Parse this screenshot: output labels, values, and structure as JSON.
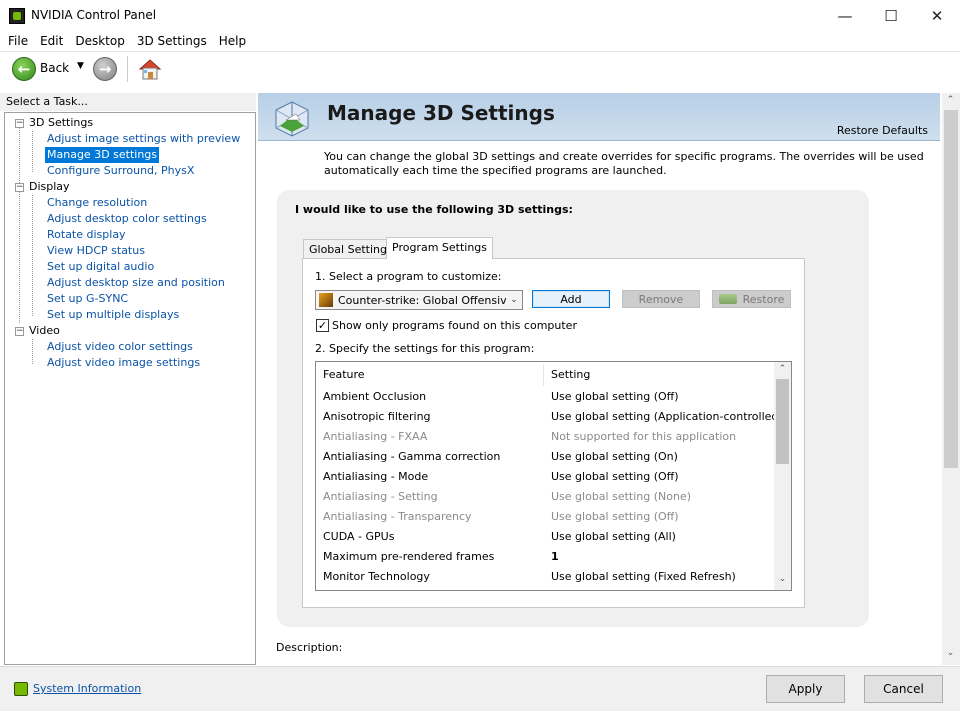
{
  "window": {
    "title": "NVIDIA Control Panel",
    "controls": {
      "minimize": "—",
      "maximize": "☐",
      "close": "✕"
    }
  },
  "menu": [
    "File",
    "Edit",
    "Desktop",
    "3D Settings",
    "Help"
  ],
  "toolbar": {
    "back_label": "Back",
    "icons": [
      "back-arrow-icon",
      "forward-arrow-icon",
      "home-icon"
    ]
  },
  "left_pane": {
    "header": "Select a Task...",
    "tree": [
      {
        "label": "3D Settings",
        "children": [
          "Adjust image settings with preview",
          "Manage 3D settings",
          "Configure Surround, PhysX"
        ]
      },
      {
        "label": "Display",
        "children": [
          "Change resolution",
          "Adjust desktop color settings",
          "Rotate display",
          "View HDCP status",
          "Set up digital audio",
          "Adjust desktop size and position",
          "Set up G-SYNC",
          "Set up multiple displays"
        ]
      },
      {
        "label": "Video",
        "children": [
          "Adjust video color settings",
          "Adjust video image settings"
        ]
      }
    ],
    "selected": "Manage 3D settings"
  },
  "main": {
    "title": "Manage 3D Settings",
    "restore_defaults": "Restore Defaults",
    "intro": "You can change the global 3D settings and create overrides for specific programs. The overrides will be used automatically each time the specified programs are launched.",
    "heading": "I would like to use the following 3D settings:",
    "tabs": [
      "Global Settings",
      "Program Settings"
    ],
    "active_tab": "Program Settings",
    "step1_label": "1. Select a program to customize:",
    "selected_program": "Counter-strike: Global Offensiv...",
    "add_label": "Add",
    "remove_label": "Remove",
    "restore_label": "Restore",
    "show_only_label": "Show only programs found on this computer",
    "show_only_checked": "✓",
    "step2_label": "2. Specify the settings for this program:",
    "table": {
      "headers": [
        "Feature",
        "Setting"
      ],
      "rows": [
        {
          "feature": "Ambient Occlusion",
          "setting": "Use global setting (Off)",
          "disabled": false,
          "bold": false
        },
        {
          "feature": "Anisotropic filtering",
          "setting": "Use global setting (Application-controlled)",
          "disabled": false,
          "bold": false
        },
        {
          "feature": "Antialiasing - FXAA",
          "setting": "Not supported for this application",
          "disabled": true,
          "bold": false
        },
        {
          "feature": "Antialiasing - Gamma correction",
          "setting": "Use global setting (On)",
          "disabled": false,
          "bold": false
        },
        {
          "feature": "Antialiasing - Mode",
          "setting": "Use global setting (Off)",
          "disabled": false,
          "bold": false
        },
        {
          "feature": "Antialiasing - Setting",
          "setting": "Use global setting (None)",
          "disabled": true,
          "bold": false
        },
        {
          "feature": "Antialiasing - Transparency",
          "setting": "Use global setting (Off)",
          "disabled": true,
          "bold": false
        },
        {
          "feature": "CUDA - GPUs",
          "setting": "Use global setting (All)",
          "disabled": false,
          "bold": false
        },
        {
          "feature": "Maximum pre-rendered frames",
          "setting": "1",
          "disabled": false,
          "bold": true
        },
        {
          "feature": "Monitor Technology",
          "setting": "Use global setting (Fixed Refresh)",
          "disabled": false,
          "bold": false
        }
      ]
    },
    "description_label": "Description:"
  },
  "bottom": {
    "system_info": "System Information",
    "apply_label": "Apply",
    "cancel_label": "Cancel"
  },
  "colors": {
    "accent_blue": "#0078d7",
    "link_blue": "#0a53a6",
    "banner": "#b7cfe6",
    "nvidia_green": "#76b900",
    "panel_gray": "#f0f0f0"
  }
}
